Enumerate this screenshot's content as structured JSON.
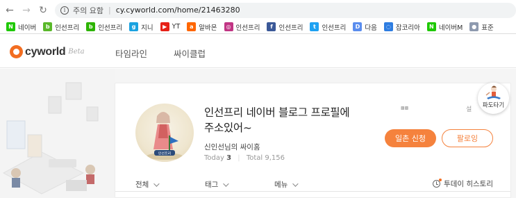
{
  "browser": {
    "security_label": "주의 요함",
    "separator": "|",
    "url": "cy.cyworld.com/home/21463280"
  },
  "bookmarks": [
    {
      "label": "네이버",
      "icon": "naver-icon",
      "color": "#1ec800",
      "glyph": "N"
    },
    {
      "label": "인선프리",
      "icon": "blog-icon",
      "color": "#5ab82a",
      "glyph": "b"
    },
    {
      "label": "인선프리",
      "icon": "blog-icon",
      "color": "#2db400",
      "glyph": "b"
    },
    {
      "label": "지니",
      "icon": "genie-icon",
      "color": "#1aa2e0",
      "glyph": "g"
    },
    {
      "label": "YT",
      "icon": "youtube-icon",
      "color": "#e62117",
      "glyph": "▶"
    },
    {
      "label": "알바몬",
      "icon": "albamon-icon",
      "color": "#ff6600",
      "glyph": "a"
    },
    {
      "label": "인선프리",
      "icon": "instagram-icon",
      "color": "#c13584",
      "glyph": "◎"
    },
    {
      "label": "인선프리",
      "icon": "facebook-icon",
      "color": "#3b5998",
      "glyph": "f"
    },
    {
      "label": "인선프리",
      "icon": "twitter-icon",
      "color": "#1da1f2",
      "glyph": "t"
    },
    {
      "label": "다음",
      "icon": "daum-icon",
      "color": "#5a8dee",
      "glyph": "D"
    },
    {
      "label": "잡코리아",
      "icon": "jobkorea-icon",
      "color": "#2e7de1",
      "glyph": "◌"
    },
    {
      "label": "네이버M",
      "icon": "naver-icon",
      "color": "#1ec800",
      "glyph": "N"
    },
    {
      "label": "표준",
      "icon": "profile-icon",
      "color": "#8e9aaf",
      "glyph": "●"
    }
  ],
  "header": {
    "logo_text": "cyworld",
    "logo_beta": "Beta",
    "menu": [
      "타임라인",
      "싸이클럽"
    ]
  },
  "profile": {
    "title": "인선프리 네이버 블로그 프로필에 주소있어~",
    "owner": "신인선님의 싸이홈",
    "today_label": "Today",
    "today_value": "3",
    "total_label": "Total",
    "total_value": "9,156",
    "ilchon_button": "일촌 신청",
    "follow_button": "팔로잉",
    "settings_label": "설"
  },
  "tabs": {
    "all": "전체",
    "tag": "태그",
    "menu": "메뉴",
    "history": "투데이 히스토리"
  },
  "padotagi": "파도타기",
  "colors": {
    "accent": "#f5823d",
    "logo_orange": "#f26d21"
  }
}
